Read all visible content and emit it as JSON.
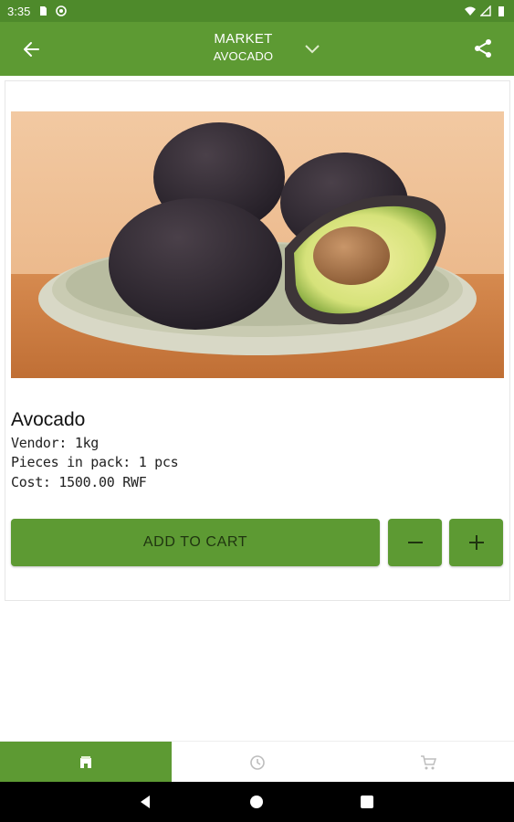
{
  "status_bar": {
    "time": "3:35"
  },
  "app_bar": {
    "title": "MARKET",
    "subtitle": "AVOCADO"
  },
  "product": {
    "name": "Avocado",
    "vendor": "Vendor: 1kg",
    "pieces": "Pieces in pack: 1 pcs",
    "cost": "Cost: 1500.00 RWF"
  },
  "actions": {
    "add_to_cart_label": "ADD TO CART"
  },
  "bottom_nav": {
    "tabs": [
      {
        "icon": "store-icon"
      },
      {
        "icon": "history-clock-icon"
      },
      {
        "icon": "cart-icon"
      }
    ]
  },
  "colors": {
    "brand": "#5d9a33",
    "status_bar": "#4e8a2b",
    "button_text": "#1f3410"
  }
}
